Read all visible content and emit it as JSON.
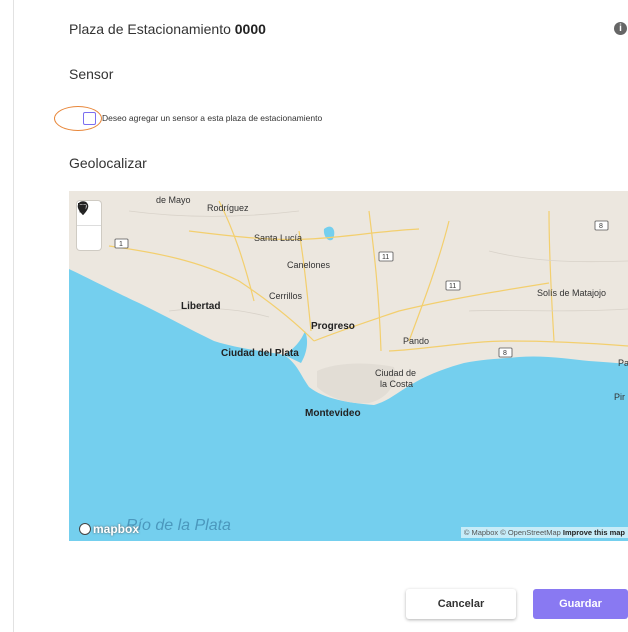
{
  "header": {
    "title_prefix": "Plaza de Estacionamiento",
    "title_number": "0000",
    "info_icon": "i"
  },
  "sensor": {
    "section_label": "Sensor",
    "checkbox_label": "Deseo agregar un sensor a esta plaza de estacionamiento",
    "checked": false
  },
  "geo": {
    "section_label": "Geolocalizar"
  },
  "map": {
    "places": {
      "de_mayo": "de Mayo",
      "rodriguez": "Rodríguez",
      "santa_lucia": "Santa Lucía",
      "canelones": "Canelones",
      "libertad": "Libertad",
      "cerrillos": "Cerrillos",
      "progreso": "Progreso",
      "pando": "Pando",
      "solis": "Solís de Matajojo",
      "ciudad_del_plata": "Ciudad del Plata",
      "ciudad_de": "Ciudad de",
      "la_costa": "la Costa",
      "montevideo": "Montevideo",
      "pa": "Pa",
      "pir": "Pir",
      "rio_de_la_plata": "Río de la Plata"
    },
    "route_shields": [
      "1",
      "11",
      "11",
      "8",
      "8"
    ],
    "tools": {
      "marker": "map-marker-icon",
      "trash": "trash-icon"
    },
    "logo_text": "mapbox",
    "attribution_prefix": "© Mapbox © OpenStreetMap",
    "attribution_link": "Improve this map",
    "colors": {
      "water": "#74cfee",
      "land": "#ece7df",
      "accent": "#8979f2"
    }
  },
  "actions": {
    "cancel_label": "Cancelar",
    "save_label": "Guardar"
  }
}
